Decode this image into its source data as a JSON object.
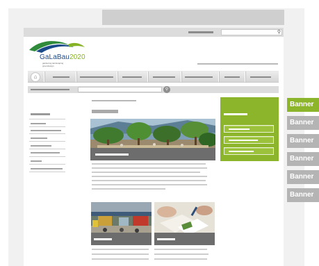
{
  "logo": {
    "name": "GaLaBau",
    "year": "2020",
    "tagline": "gardening landscaping greendesign"
  },
  "header": {
    "search_icon": "magnifier-icon"
  },
  "nav": {
    "home_icon": "home-icon",
    "item_count": 6
  },
  "crumb": {
    "go_icon": "magnifier-icon"
  },
  "colors": {
    "accent_green": "#8db52c",
    "banner_green": "#8db52c",
    "banner_grey": "#b4b4b4",
    "logo_blue": "#1a4a8a",
    "logo_green": "#86b226",
    "caption_grey": "#6d6d6d"
  },
  "banners": [
    {
      "label": "Banner",
      "active": true
    },
    {
      "label": "Banner",
      "active": false
    },
    {
      "label": "Banner",
      "active": false
    },
    {
      "label": "Banner",
      "active": false
    },
    {
      "label": "Banner",
      "active": false
    },
    {
      "label": "Banner",
      "active": false
    }
  ]
}
